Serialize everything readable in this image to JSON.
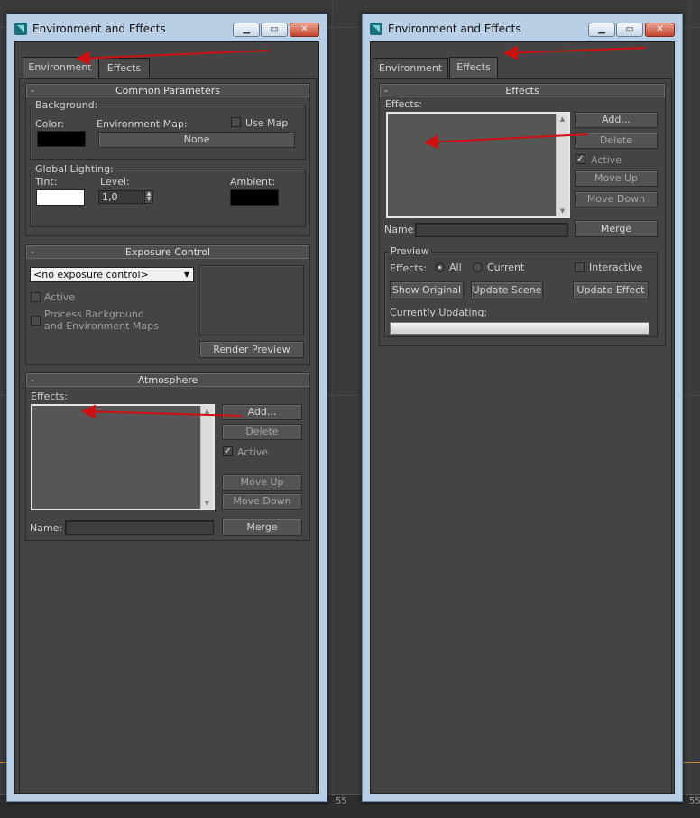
{
  "left_window": {
    "title": "Environment and Effects",
    "tabs": [
      "Environment",
      "Effects"
    ],
    "active_tab": "Environment",
    "common_parameters": {
      "header": "Common Parameters",
      "background": {
        "group_label": "Background:",
        "color_label": "Color:",
        "color": "#000000",
        "env_map_label": "Environment Map:",
        "use_map_label": "Use Map",
        "use_map_checked": false,
        "map_button": "None"
      },
      "global_lighting": {
        "group_label": "Global Lighting:",
        "tint_label": "Tint:",
        "tint": "#ffffff",
        "level_label": "Level:",
        "level_value": "1,0",
        "ambient_label": "Ambient:",
        "ambient": "#000000"
      }
    },
    "exposure_control": {
      "header": "Exposure Control",
      "dropdown_value": "<no exposure control>",
      "active_label": "Active",
      "process_bg_label_line1": "Process Background",
      "process_bg_label_line2": "and Environment Maps",
      "render_preview": "Render Preview"
    },
    "atmosphere": {
      "header": "Atmosphere",
      "effects_label": "Effects:",
      "add": "Add...",
      "delete": "Delete",
      "active_label": "Active",
      "active_checked": true,
      "move_up": "Move Up",
      "move_down": "Move Down",
      "name_label": "Name:",
      "merge": "Merge"
    }
  },
  "right_window": {
    "title": "Environment and Effects",
    "tabs": [
      "Environment",
      "Effects"
    ],
    "active_tab": "Effects",
    "effects": {
      "header": "Effects",
      "effects_label": "Effects:",
      "add": "Add...",
      "delete": "Delete",
      "active_label": "Active",
      "active_checked": true,
      "move_up": "Move Up",
      "move_down": "Move Down",
      "name_label": "Name:",
      "merge": "Merge"
    },
    "preview": {
      "group_label": "Preview",
      "effects_label": "Effects:",
      "all_label": "All",
      "current_label": "Current",
      "selected": "All",
      "interactive_label": "Interactive",
      "interactive_checked": false,
      "show_original": "Show Original",
      "update_scene": "Update Scene",
      "update_effect": "Update Effect",
      "currently_updating": "Currently Updating:"
    }
  },
  "ruler_numbers": [
    "55",
    "55"
  ],
  "colors": {
    "annotation_arrow": "#d01010",
    "title_accent": "#b9cfe6"
  }
}
